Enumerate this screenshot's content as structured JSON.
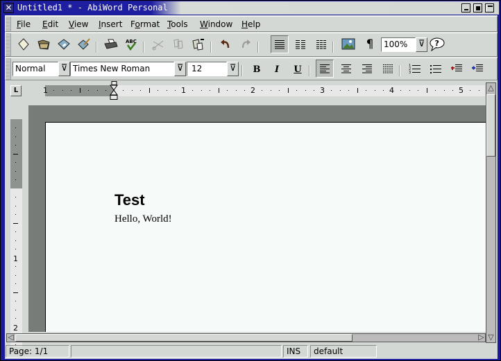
{
  "window": {
    "title": "Untitled1 * - AbiWord Personal",
    "close_icon": "x-icon",
    "controls": [
      "minimize",
      "maximize",
      "shade"
    ]
  },
  "menubar": {
    "items": [
      {
        "label": "File",
        "mnemonic": "F"
      },
      {
        "label": "Edit",
        "mnemonic": "E"
      },
      {
        "label": "View",
        "mnemonic": "V"
      },
      {
        "label": "Insert",
        "mnemonic": "I"
      },
      {
        "label": "Format",
        "mnemonic": "o"
      },
      {
        "label": "Tools",
        "mnemonic": "T"
      },
      {
        "label": "Window",
        "mnemonic": "W"
      },
      {
        "label": "Help",
        "mnemonic": "H"
      }
    ]
  },
  "toolbar_standard": {
    "buttons": [
      "new-document",
      "open-folder",
      "save-floppy",
      "save-as",
      "print",
      "spell-check",
      "cut",
      "copy",
      "paste",
      "undo",
      "redo",
      "one-column",
      "two-columns",
      "three-columns",
      "insert-image",
      "show-formatting"
    ],
    "zoom": {
      "value": "100%"
    },
    "help_icon": "help-speech-bubble"
  },
  "toolbar_format": {
    "style": {
      "value": "Normal"
    },
    "font": {
      "value": "Times New Roman"
    },
    "size": {
      "value": "12"
    },
    "bold": "B",
    "italic": "I",
    "underline": "U",
    "alignments": [
      "align-left",
      "align-center",
      "align-right",
      "justify"
    ],
    "active_alignment": "align-left",
    "lists": [
      "numbered-list",
      "bulleted-list"
    ],
    "indent": [
      "decrease-indent",
      "increase-indent"
    ]
  },
  "ruler": {
    "tab_stop_glyph": "L",
    "horizontal_labels": [
      "1",
      "1",
      "2",
      "3",
      "4",
      "5"
    ],
    "vertical_labels": [
      "1",
      "2"
    ]
  },
  "document": {
    "heading": "Test",
    "body": "Hello, World!"
  },
  "statusbar": {
    "page": "Page: 1/1",
    "message": "",
    "mode": "INS",
    "language": "default"
  },
  "colors": {
    "titlebar_active": "#1e1ea0",
    "chrome": "#d4d8d4",
    "doc_background": "#787c78",
    "page": "#f6faf8"
  }
}
